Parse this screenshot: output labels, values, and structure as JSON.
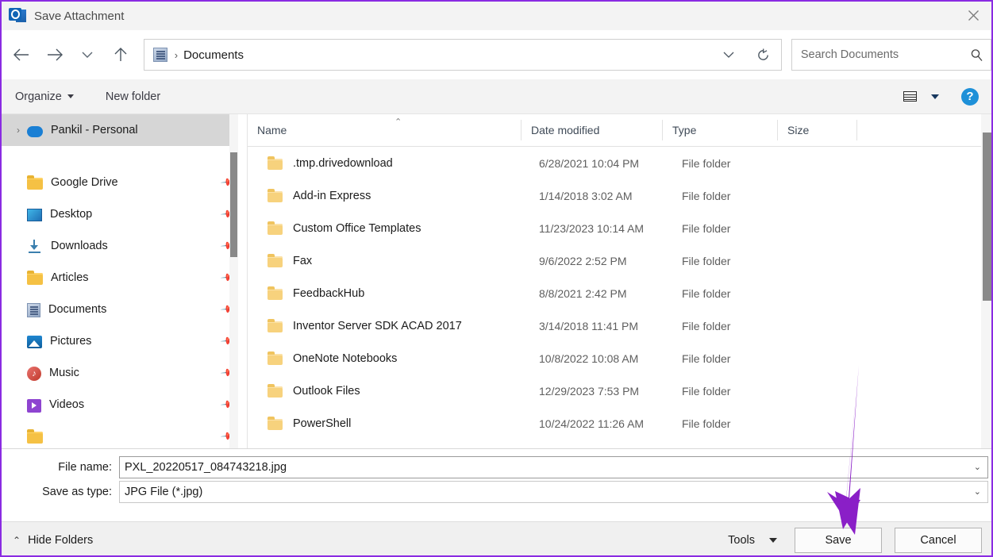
{
  "window": {
    "title": "Save Attachment",
    "app_icon": "outlook-attachment-icon",
    "close_label": "✕",
    "accent_color": "#8A2BE2"
  },
  "nav": {
    "back_label": "←",
    "forward_label": "→",
    "recent_label": "⌄",
    "up_label": "↑",
    "address": {
      "icon": "documents-folder-icon",
      "separator": "›",
      "crumb": "Documents",
      "history_caret": "⌄",
      "refresh_label": "⟳"
    },
    "search": {
      "placeholder": "Search Documents",
      "value": "",
      "icon": "search-icon"
    }
  },
  "commandbar": {
    "organize_label": "Organize",
    "new_folder_label": "New folder",
    "view_icon": "list-view-icon",
    "view_caret": "▼",
    "help_label": "?"
  },
  "sidebar": {
    "items": [
      {
        "label": "Pankil - Personal",
        "icon": "onedrive-cloud-icon",
        "expander": "›",
        "selected": true,
        "pinned": false,
        "icon_class": "ico-cloud"
      },
      {
        "label": "Google Drive",
        "icon": "folder-icon",
        "expander": "",
        "selected": false,
        "pinned": true,
        "icon_class": "ico-folder"
      },
      {
        "label": "Desktop",
        "icon": "desktop-icon",
        "expander": "",
        "selected": false,
        "pinned": true,
        "icon_class": "ico-desktop"
      },
      {
        "label": "Downloads",
        "icon": "downloads-icon",
        "expander": "",
        "selected": false,
        "pinned": true,
        "icon_class": "ico-download"
      },
      {
        "label": "Articles",
        "icon": "folder-icon",
        "expander": "",
        "selected": false,
        "pinned": true,
        "icon_class": "ico-folder"
      },
      {
        "label": "Documents",
        "icon": "documents-icon",
        "expander": "",
        "selected": false,
        "pinned": true,
        "icon_class": "ico-docs"
      },
      {
        "label": "Pictures",
        "icon": "pictures-icon",
        "expander": "",
        "selected": false,
        "pinned": true,
        "icon_class": "ico-pictures"
      },
      {
        "label": "Music",
        "icon": "music-icon",
        "expander": "",
        "selected": false,
        "pinned": true,
        "icon_class": "ico-music"
      },
      {
        "label": "Videos",
        "icon": "videos-icon",
        "expander": "",
        "selected": false,
        "pinned": true,
        "icon_class": "ico-videos"
      },
      {
        "label": "",
        "icon": "folder-icon",
        "expander": "",
        "selected": false,
        "pinned": true,
        "icon_class": "ico-folder"
      }
    ],
    "pin_glyph": "📌"
  },
  "filelist": {
    "sort_caret": "⌃",
    "columns": [
      "Name",
      "Date modified",
      "Type",
      "Size"
    ],
    "rows": [
      {
        "name": ".tmp.drivedownload",
        "date": "6/28/2021 10:04 PM",
        "type": "File folder",
        "size": ""
      },
      {
        "name": "Add-in Express",
        "date": "1/14/2018 3:02 AM",
        "type": "File folder",
        "size": ""
      },
      {
        "name": "Custom Office Templates",
        "date": "11/23/2023 10:14 AM",
        "type": "File folder",
        "size": ""
      },
      {
        "name": "Fax",
        "date": "9/6/2022 2:52 PM",
        "type": "File folder",
        "size": ""
      },
      {
        "name": "FeedbackHub",
        "date": "8/8/2021 2:42 PM",
        "type": "File folder",
        "size": ""
      },
      {
        "name": "Inventor Server SDK ACAD 2017",
        "date": "3/14/2018 11:41 PM",
        "type": "File folder",
        "size": ""
      },
      {
        "name": "OneNote Notebooks",
        "date": "10/8/2022 10:08 AM",
        "type": "File folder",
        "size": ""
      },
      {
        "name": "Outlook Files",
        "date": "12/29/2023 7:53 PM",
        "type": "File folder",
        "size": ""
      },
      {
        "name": "PowerShell",
        "date": "10/24/2022 11:26 AM",
        "type": "File folder",
        "size": ""
      }
    ]
  },
  "form": {
    "file_name_label": "File name:",
    "file_name_value": "PXL_20220517_084743218.jpg",
    "save_as_type_label": "Save as type:",
    "save_as_type_value": "JPG File (*.jpg)",
    "caret": "⌄"
  },
  "footer": {
    "hide_folders_label": "Hide Folders",
    "hide_folders_caret": "⌃",
    "tools_label": "Tools",
    "save_label": "Save",
    "cancel_label": "Cancel"
  },
  "annotation": {
    "type": "arrow",
    "color": "#8A1FC7",
    "points_to": "save-button"
  }
}
